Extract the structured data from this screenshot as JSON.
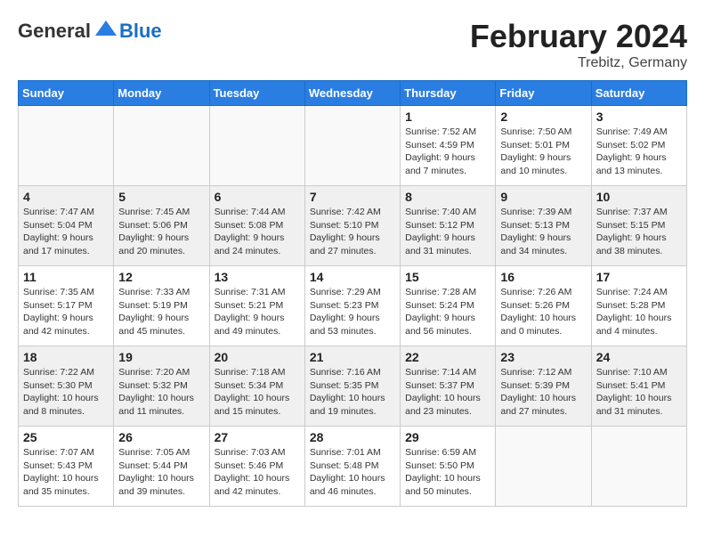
{
  "header": {
    "logo_general": "General",
    "logo_blue": "Blue",
    "month": "February 2024",
    "location": "Trebitz, Germany"
  },
  "weekdays": [
    "Sunday",
    "Monday",
    "Tuesday",
    "Wednesday",
    "Thursday",
    "Friday",
    "Saturday"
  ],
  "weeks": [
    [
      {
        "day": "",
        "info": ""
      },
      {
        "day": "",
        "info": ""
      },
      {
        "day": "",
        "info": ""
      },
      {
        "day": "",
        "info": ""
      },
      {
        "day": "1",
        "info": "Sunrise: 7:52 AM\nSunset: 4:59 PM\nDaylight: 9 hours\nand 7 minutes."
      },
      {
        "day": "2",
        "info": "Sunrise: 7:50 AM\nSunset: 5:01 PM\nDaylight: 9 hours\nand 10 minutes."
      },
      {
        "day": "3",
        "info": "Sunrise: 7:49 AM\nSunset: 5:02 PM\nDaylight: 9 hours\nand 13 minutes."
      }
    ],
    [
      {
        "day": "4",
        "info": "Sunrise: 7:47 AM\nSunset: 5:04 PM\nDaylight: 9 hours\nand 17 minutes."
      },
      {
        "day": "5",
        "info": "Sunrise: 7:45 AM\nSunset: 5:06 PM\nDaylight: 9 hours\nand 20 minutes."
      },
      {
        "day": "6",
        "info": "Sunrise: 7:44 AM\nSunset: 5:08 PM\nDaylight: 9 hours\nand 24 minutes."
      },
      {
        "day": "7",
        "info": "Sunrise: 7:42 AM\nSunset: 5:10 PM\nDaylight: 9 hours\nand 27 minutes."
      },
      {
        "day": "8",
        "info": "Sunrise: 7:40 AM\nSunset: 5:12 PM\nDaylight: 9 hours\nand 31 minutes."
      },
      {
        "day": "9",
        "info": "Sunrise: 7:39 AM\nSunset: 5:13 PM\nDaylight: 9 hours\nand 34 minutes."
      },
      {
        "day": "10",
        "info": "Sunrise: 7:37 AM\nSunset: 5:15 PM\nDaylight: 9 hours\nand 38 minutes."
      }
    ],
    [
      {
        "day": "11",
        "info": "Sunrise: 7:35 AM\nSunset: 5:17 PM\nDaylight: 9 hours\nand 42 minutes."
      },
      {
        "day": "12",
        "info": "Sunrise: 7:33 AM\nSunset: 5:19 PM\nDaylight: 9 hours\nand 45 minutes."
      },
      {
        "day": "13",
        "info": "Sunrise: 7:31 AM\nSunset: 5:21 PM\nDaylight: 9 hours\nand 49 minutes."
      },
      {
        "day": "14",
        "info": "Sunrise: 7:29 AM\nSunset: 5:23 PM\nDaylight: 9 hours\nand 53 minutes."
      },
      {
        "day": "15",
        "info": "Sunrise: 7:28 AM\nSunset: 5:24 PM\nDaylight: 9 hours\nand 56 minutes."
      },
      {
        "day": "16",
        "info": "Sunrise: 7:26 AM\nSunset: 5:26 PM\nDaylight: 10 hours\nand 0 minutes."
      },
      {
        "day": "17",
        "info": "Sunrise: 7:24 AM\nSunset: 5:28 PM\nDaylight: 10 hours\nand 4 minutes."
      }
    ],
    [
      {
        "day": "18",
        "info": "Sunrise: 7:22 AM\nSunset: 5:30 PM\nDaylight: 10 hours\nand 8 minutes."
      },
      {
        "day": "19",
        "info": "Sunrise: 7:20 AM\nSunset: 5:32 PM\nDaylight: 10 hours\nand 11 minutes."
      },
      {
        "day": "20",
        "info": "Sunrise: 7:18 AM\nSunset: 5:34 PM\nDaylight: 10 hours\nand 15 minutes."
      },
      {
        "day": "21",
        "info": "Sunrise: 7:16 AM\nSunset: 5:35 PM\nDaylight: 10 hours\nand 19 minutes."
      },
      {
        "day": "22",
        "info": "Sunrise: 7:14 AM\nSunset: 5:37 PM\nDaylight: 10 hours\nand 23 minutes."
      },
      {
        "day": "23",
        "info": "Sunrise: 7:12 AM\nSunset: 5:39 PM\nDaylight: 10 hours\nand 27 minutes."
      },
      {
        "day": "24",
        "info": "Sunrise: 7:10 AM\nSunset: 5:41 PM\nDaylight: 10 hours\nand 31 minutes."
      }
    ],
    [
      {
        "day": "25",
        "info": "Sunrise: 7:07 AM\nSunset: 5:43 PM\nDaylight: 10 hours\nand 35 minutes."
      },
      {
        "day": "26",
        "info": "Sunrise: 7:05 AM\nSunset: 5:44 PM\nDaylight: 10 hours\nand 39 minutes."
      },
      {
        "day": "27",
        "info": "Sunrise: 7:03 AM\nSunset: 5:46 PM\nDaylight: 10 hours\nand 42 minutes."
      },
      {
        "day": "28",
        "info": "Sunrise: 7:01 AM\nSunset: 5:48 PM\nDaylight: 10 hours\nand 46 minutes."
      },
      {
        "day": "29",
        "info": "Sunrise: 6:59 AM\nSunset: 5:50 PM\nDaylight: 10 hours\nand 50 minutes."
      },
      {
        "day": "",
        "info": ""
      },
      {
        "day": "",
        "info": ""
      }
    ]
  ]
}
